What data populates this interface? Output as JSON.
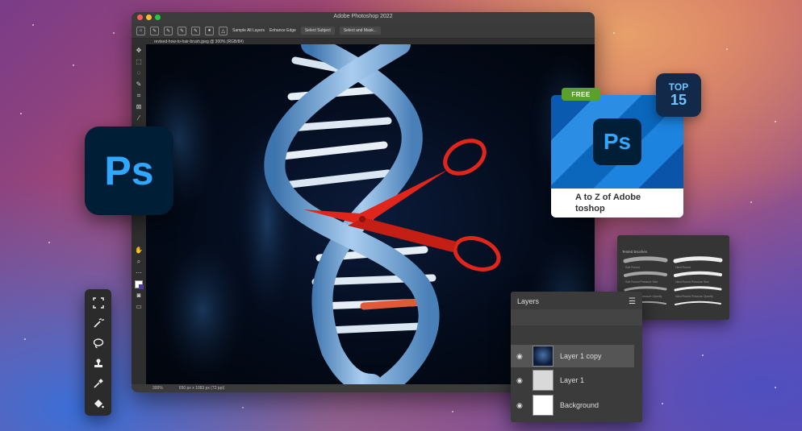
{
  "window": {
    "title": "Adobe Photoshop 2022",
    "doc_tab": "revised-how-to-hair-brush.jpeg @ 300% (RGB/8#)",
    "options": {
      "sample_all_layers": "Sample All Layers",
      "enhance_edge": "Enhance Edge",
      "select_subject": "Select Subject",
      "select_and_mask": "Select and Mask..."
    },
    "status": {
      "zoom": "300%",
      "dimensions": "650 px x 1083 px (72 ppi)"
    }
  },
  "ps_logo": "Ps",
  "card": {
    "badge_free": "FREE",
    "badge_top_line1": "TOP",
    "badge_top_line2": "15",
    "logo": "Ps",
    "title_line1": "A to Z of Adobe",
    "title_line2": "toshop"
  },
  "brushes": {
    "header": "Tested Brushes",
    "items": [
      "Soft Round",
      "Hard Round",
      "Soft Round Pressure Size",
      "Hard Round Pressure Size",
      "Soft Round Pressure Opacity",
      "Hard Round Pressure Opacity"
    ]
  },
  "layers": {
    "title": "Layers",
    "rows": [
      {
        "name": "Layer 1 copy",
        "selected": true
      },
      {
        "name": "Layer 1",
        "selected": false
      },
      {
        "name": "Background",
        "selected": false
      }
    ]
  },
  "colors": {
    "ps_blue": "#31a8ff",
    "ps_dark": "#001e36",
    "free_green": "#5aa02c",
    "dna_blue": "#6fa8dc",
    "scissors_red": "#e0261c"
  },
  "icons": [
    "close-dot",
    "minimize-dot",
    "zoom-dot",
    "marquee-icon",
    "magic-wand-icon",
    "lasso-icon",
    "stamp-icon",
    "eyedropper-icon",
    "paint-bucket-icon",
    "eye-icon",
    "menu-icon"
  ]
}
